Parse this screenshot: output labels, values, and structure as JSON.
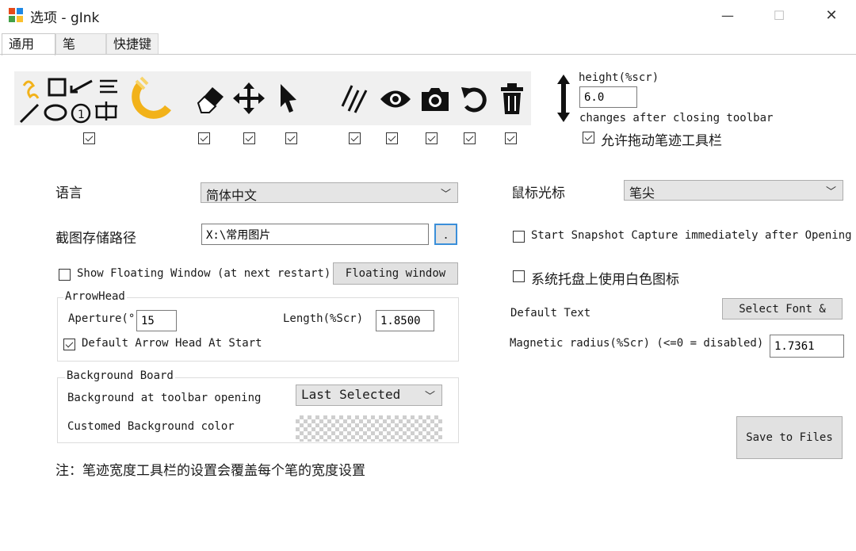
{
  "window": {
    "title": "选项 - gInk",
    "minimize_glyph": "—",
    "maximize_glyph": "☐",
    "close_glyph": "✕"
  },
  "tabs": [
    {
      "label": "通用",
      "active": true
    },
    {
      "label": "笔",
      "active": false
    },
    {
      "label": "快捷键",
      "active": false
    }
  ],
  "toolbar": {
    "icons": [
      "pen-shapes-icon",
      "magnet-icon",
      "eraser-icon",
      "move-icon",
      "pointer-icon",
      "pen-width-icon",
      "eye-icon",
      "camera-icon",
      "undo-icon",
      "trash-icon"
    ],
    "checkboxes": [
      true,
      true,
      true,
      true,
      true,
      true,
      true,
      true,
      true
    ]
  },
  "height_panel": {
    "label": "height(%scr)",
    "value": "6.0",
    "note": "changes after closing toolbar",
    "allow_drag_label": "允许拖动笔迹工具栏",
    "allow_drag_checked": true
  },
  "language": {
    "label": "语言",
    "value": "简体中文"
  },
  "cursor": {
    "label": "鼠标光标",
    "value": "笔尖"
  },
  "snapshot_path": {
    "label": "截图存储路径",
    "value": "X:\\常用图片",
    "browse_label": "."
  },
  "snapshot_capture": {
    "label": "Start Snapshot Capture immediately after Opening",
    "checked": false
  },
  "floating": {
    "label": "Show Floating Window (at next restart)",
    "checked": false,
    "button_label": "Floating window"
  },
  "white_tray": {
    "label": "系统托盘上使用白色图标",
    "checked": false
  },
  "arrowhead": {
    "group_title": "ArrowHead",
    "aperture_label": "Aperture(°",
    "aperture_value": "15",
    "length_label": "Length(%Scr)",
    "length_value": "1.8500",
    "default_label": "Default Arrow Head At Start",
    "default_checked": true
  },
  "default_text": {
    "label": "Default Text",
    "button_label": "Select Font &"
  },
  "magnetic": {
    "label": "Magnetic radius(%Scr) (<=0 = disabled)",
    "value": "1.7361"
  },
  "background_board": {
    "group_title": "Background Board",
    "opening_label": "Background at toolbar opening",
    "opening_value": "Last Selected",
    "color_label": "Customed Background color"
  },
  "save_button": "Save to Files",
  "note": "注：笔迹宽度工具栏的设置会覆盖每个笔的宽度设置"
}
